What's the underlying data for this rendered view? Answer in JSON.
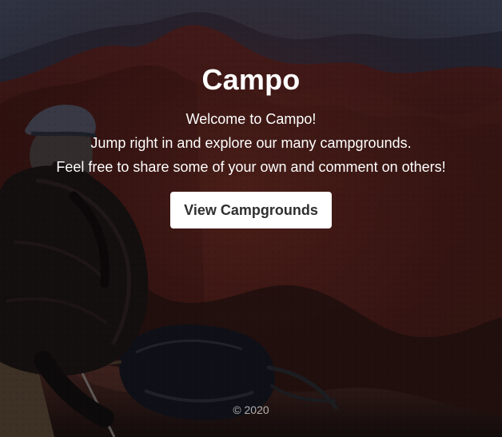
{
  "hero": {
    "title": "Campo",
    "welcome": "Welcome to Campo!",
    "line_two": "Jump right in and explore our many campgrounds.",
    "line_three": "Feel free to share some of your own and comment on others!",
    "cta_label": "View Campgrounds"
  },
  "footer": {
    "copyright": "© 2020"
  },
  "colors": {
    "button_bg": "#ffffff",
    "button_text": "#2f2f2f",
    "hero_text": "#ffffff",
    "footer_text": "#a7a7a7"
  }
}
